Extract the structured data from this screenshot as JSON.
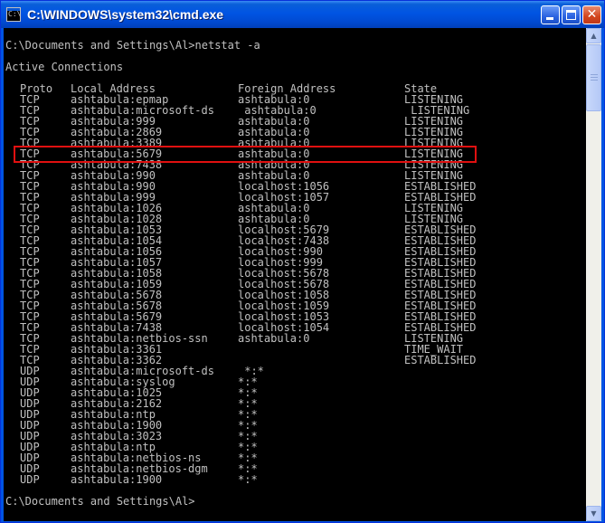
{
  "window": {
    "title": "C:\\WINDOWS\\system32\\cmd.exe",
    "icon": "cmd-icon",
    "icon_glyph": "C:\\",
    "buttons": {
      "minimize": "minimize-icon",
      "maximize": "maximize-icon",
      "close": "close-icon",
      "close_glyph": "✕"
    }
  },
  "console": {
    "prompt_command": "C:\\Documents and Settings\\Al>netstat -a",
    "section_title": "Active Connections",
    "headers": {
      "proto": "Proto",
      "local": "Local Address",
      "foreign": "Foreign Address",
      "state": "State"
    },
    "rows": [
      {
        "proto": "TCP",
        "local": "ashtabula:epmap",
        "foreign": "ashtabula:0",
        "state": "LISTENING"
      },
      {
        "proto": "TCP",
        "local": "ashtabula:microsoft-ds",
        "foreign": " ashtabula:0",
        "state": " LISTENING"
      },
      {
        "proto": "TCP",
        "local": "ashtabula:999",
        "foreign": "ashtabula:0",
        "state": "LISTENING"
      },
      {
        "proto": "TCP",
        "local": "ashtabula:2869",
        "foreign": "ashtabula:0",
        "state": "LISTENING"
      },
      {
        "proto": "TCP",
        "local": "ashtabula:3389",
        "foreign": "ashtabula:0",
        "state": "LISTENING"
      },
      {
        "proto": "TCP",
        "local": "ashtabula:5679",
        "foreign": "ashtabula:0",
        "state": "LISTENING"
      },
      {
        "proto": "TCP",
        "local": "ashtabula:7438",
        "foreign": "ashtabula:0",
        "state": "LISTENING"
      },
      {
        "proto": "TCP",
        "local": "ashtabula:990",
        "foreign": "ashtabula:0",
        "state": "LISTENING"
      },
      {
        "proto": "TCP",
        "local": "ashtabula:990",
        "foreign": "localhost:1056",
        "state": "ESTABLISHED"
      },
      {
        "proto": "TCP",
        "local": "ashtabula:999",
        "foreign": "localhost:1057",
        "state": "ESTABLISHED"
      },
      {
        "proto": "TCP",
        "local": "ashtabula:1026",
        "foreign": "ashtabula:0",
        "state": "LISTENING"
      },
      {
        "proto": "TCP",
        "local": "ashtabula:1028",
        "foreign": "ashtabula:0",
        "state": "LISTENING"
      },
      {
        "proto": "TCP",
        "local": "ashtabula:1053",
        "foreign": "localhost:5679",
        "state": "ESTABLISHED"
      },
      {
        "proto": "TCP",
        "local": "ashtabula:1054",
        "foreign": "localhost:7438",
        "state": "ESTABLISHED"
      },
      {
        "proto": "TCP",
        "local": "ashtabula:1056",
        "foreign": "localhost:990",
        "state": "ESTABLISHED"
      },
      {
        "proto": "TCP",
        "local": "ashtabula:1057",
        "foreign": "localhost:999",
        "state": "ESTABLISHED"
      },
      {
        "proto": "TCP",
        "local": "ashtabula:1058",
        "foreign": "localhost:5678",
        "state": "ESTABLISHED"
      },
      {
        "proto": "TCP",
        "local": "ashtabula:1059",
        "foreign": "localhost:5678",
        "state": "ESTABLISHED"
      },
      {
        "proto": "TCP",
        "local": "ashtabula:5678",
        "foreign": "localhost:1058",
        "state": "ESTABLISHED"
      },
      {
        "proto": "TCP",
        "local": "ashtabula:5678",
        "foreign": "localhost:1059",
        "state": "ESTABLISHED"
      },
      {
        "proto": "TCP",
        "local": "ashtabula:5679",
        "foreign": "localhost:1053",
        "state": "ESTABLISHED"
      },
      {
        "proto": "TCP",
        "local": "ashtabula:7438",
        "foreign": "localhost:1054",
        "state": "ESTABLISHED"
      },
      {
        "proto": "TCP",
        "local": "ashtabula:netbios-ssn",
        "foreign": "ashtabula:0",
        "state": "LISTENING"
      },
      {
        "proto": "TCP",
        "local": "ashtabula:3361",
        "foreign": "",
        "state": "TIME_WAIT"
      },
      {
        "proto": "TCP",
        "local": "ashtabula:3362",
        "foreign": "",
        "state": "ESTABLISHED"
      },
      {
        "proto": "UDP",
        "local": "ashtabula:microsoft-ds",
        "foreign": " *:*",
        "state": ""
      },
      {
        "proto": "UDP",
        "local": "ashtabula:syslog",
        "foreign": "*:*",
        "state": ""
      },
      {
        "proto": "UDP",
        "local": "ashtabula:1025",
        "foreign": "*:*",
        "state": ""
      },
      {
        "proto": "UDP",
        "local": "ashtabula:2162",
        "foreign": "*:*",
        "state": ""
      },
      {
        "proto": "UDP",
        "local": "ashtabula:ntp",
        "foreign": "*:*",
        "state": ""
      },
      {
        "proto": "UDP",
        "local": "ashtabula:1900",
        "foreign": "*:*",
        "state": ""
      },
      {
        "proto": "UDP",
        "local": "ashtabula:3023",
        "foreign": "*:*",
        "state": ""
      },
      {
        "proto": "UDP",
        "local": "ashtabula:ntp",
        "foreign": "*:*",
        "state": ""
      },
      {
        "proto": "UDP",
        "local": "ashtabula:netbios-ns",
        "foreign": "*:*",
        "state": ""
      },
      {
        "proto": "UDP",
        "local": "ashtabula:netbios-dgm",
        "foreign": "*:*",
        "state": ""
      },
      {
        "proto": "UDP",
        "local": "ashtabula:1900",
        "foreign": "*:*",
        "state": ""
      }
    ],
    "final_prompt": "C:\\Documents and Settings\\Al>",
    "highlighted_row_index": 4,
    "highlight_color": "#e01010",
    "text_color": "#c0c0c0",
    "background_color": "#000000"
  }
}
